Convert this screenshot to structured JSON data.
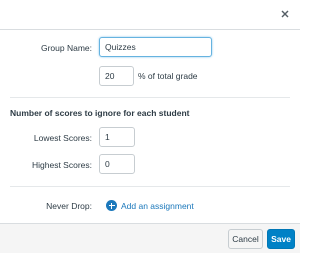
{
  "dialog": {
    "close_icon": "close-icon"
  },
  "group_name": {
    "label": "Group Name:",
    "value": "Quizzes"
  },
  "weight": {
    "value": "20",
    "suffix": "% of total grade"
  },
  "drop_rules": {
    "title": "Number of scores to ignore for each student",
    "lowest_label": "Lowest Scores:",
    "lowest_value": "1",
    "highest_label": "Highest Scores:",
    "highest_value": "0"
  },
  "never_drop": {
    "label": "Never Drop:",
    "add_icon": "plus-circle-icon",
    "add_text": "Add an assignment"
  },
  "footer": {
    "cancel_label": "Cancel",
    "save_label": "Save"
  },
  "colors": {
    "accent": "#0081c6",
    "link": "#1b78bb",
    "text": "#2d3b45"
  }
}
